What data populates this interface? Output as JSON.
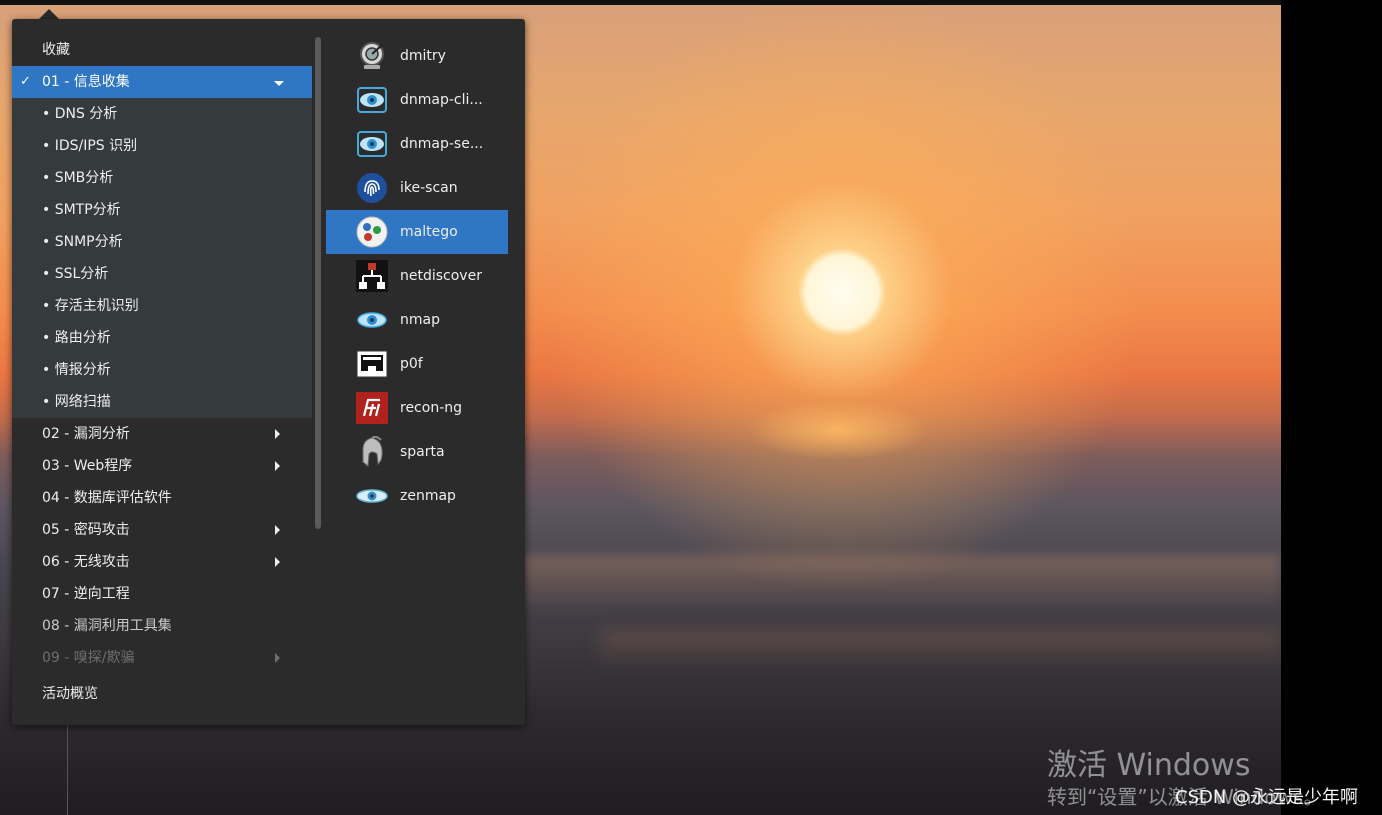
{
  "menu": {
    "favorites_label": "收藏",
    "categories": [
      {
        "label": "01 - 信息收集",
        "selected": true,
        "expanded": true
      },
      {
        "label": "02 - 漏洞分析",
        "has_submenu": true
      },
      {
        "label": "03 - Web程序",
        "has_submenu": true
      },
      {
        "label": "04 - 数据库评估软件",
        "has_submenu": false
      },
      {
        "label": "05 - 密码攻击",
        "has_submenu": true
      },
      {
        "label": "06 - 无线攻击",
        "has_submenu": true
      },
      {
        "label": "07 - 逆向工程",
        "has_submenu": false
      },
      {
        "label": "08 - 漏洞利用工具集",
        "has_submenu": false
      },
      {
        "label": "09 - 嗅探/欺骗",
        "has_submenu": true,
        "faded": true
      }
    ],
    "subcategories": [
      "• DNS 分析",
      "• IDS/IPS 识别",
      "• SMB分析",
      "• SMTP分析",
      "• SNMP分析",
      "• SSL分析",
      "• 存活主机识别",
      "• 路由分析",
      "• 情报分析",
      "• 网络扫描"
    ],
    "activities_label": "活动概览",
    "check_mark": "✓"
  },
  "apps": [
    {
      "label": "dmitry",
      "icon": "dmitry-icon"
    },
    {
      "label": "dnmap-cli...",
      "icon": "dnmap-eye-icon"
    },
    {
      "label": "dnmap-se...",
      "icon": "dnmap-eye-icon"
    },
    {
      "label": "ike-scan",
      "icon": "fingerprint-icon"
    },
    {
      "label": "maltego",
      "icon": "maltego-icon",
      "selected": true
    },
    {
      "label": "netdiscover",
      "icon": "netdiscover-icon"
    },
    {
      "label": "nmap",
      "icon": "nmap-eye-icon"
    },
    {
      "label": "p0f",
      "icon": "ethernet-port-icon"
    },
    {
      "label": "recon-ng",
      "icon": "recon-ng-icon"
    },
    {
      "label": "sparta",
      "icon": "spartan-helmet-icon"
    },
    {
      "label": "zenmap",
      "icon": "zenmap-eye-icon"
    }
  ],
  "watermark": {
    "title": "激活 Windows",
    "subtitle": "转到“设置”以激活 Windows。"
  },
  "credit": "CSDN @永远是少年啊",
  "colors": {
    "accent": "#2f76c5",
    "menu_bg": "#2b2b2b",
    "submenu_bg": "#353b3d"
  }
}
